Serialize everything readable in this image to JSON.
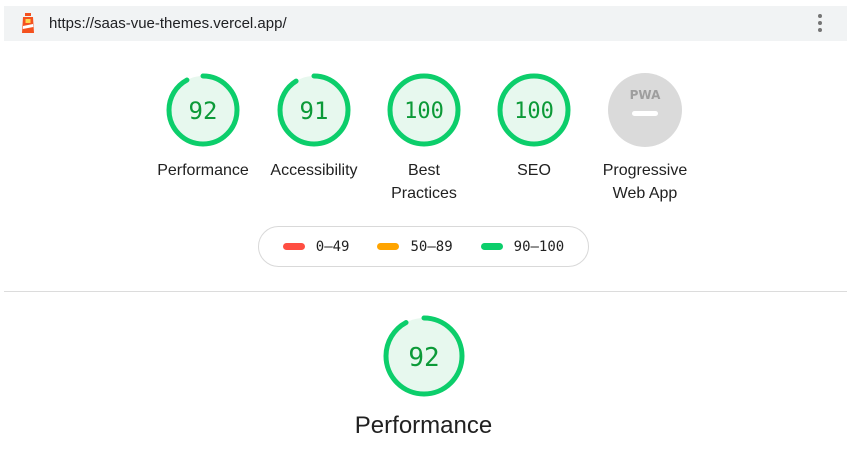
{
  "browser": {
    "url": "https://saas-vue-themes.vercel.app/"
  },
  "colors": {
    "pass": "#0cce6b",
    "pass_fill": "#e7f8ee",
    "average": "#ffa400",
    "fail": "#ff4e42",
    "pwa_gray": "#dadada"
  },
  "gauges": [
    {
      "score": "92",
      "label": "Performance",
      "status": "pass",
      "fraction": 0.92
    },
    {
      "score": "91",
      "label": "Accessibility",
      "status": "pass",
      "fraction": 0.91
    },
    {
      "score": "100",
      "label_line1": "Best",
      "label_line2": "Practices",
      "status": "pass",
      "fraction": 1.0
    },
    {
      "score": "100",
      "label": "SEO",
      "status": "pass",
      "fraction": 1.0
    },
    {
      "label_line1": "Progressive",
      "label_line2": "Web App",
      "badge_text": "PWA",
      "status": "neutral"
    }
  ],
  "legend": [
    {
      "range": "0–49",
      "color": "#ff4e42"
    },
    {
      "range": "50–89",
      "color": "#ffa400"
    },
    {
      "range": "90–100",
      "color": "#0cce6b"
    }
  ],
  "section": {
    "score": "92",
    "fraction": 0.92,
    "title": "Performance"
  }
}
